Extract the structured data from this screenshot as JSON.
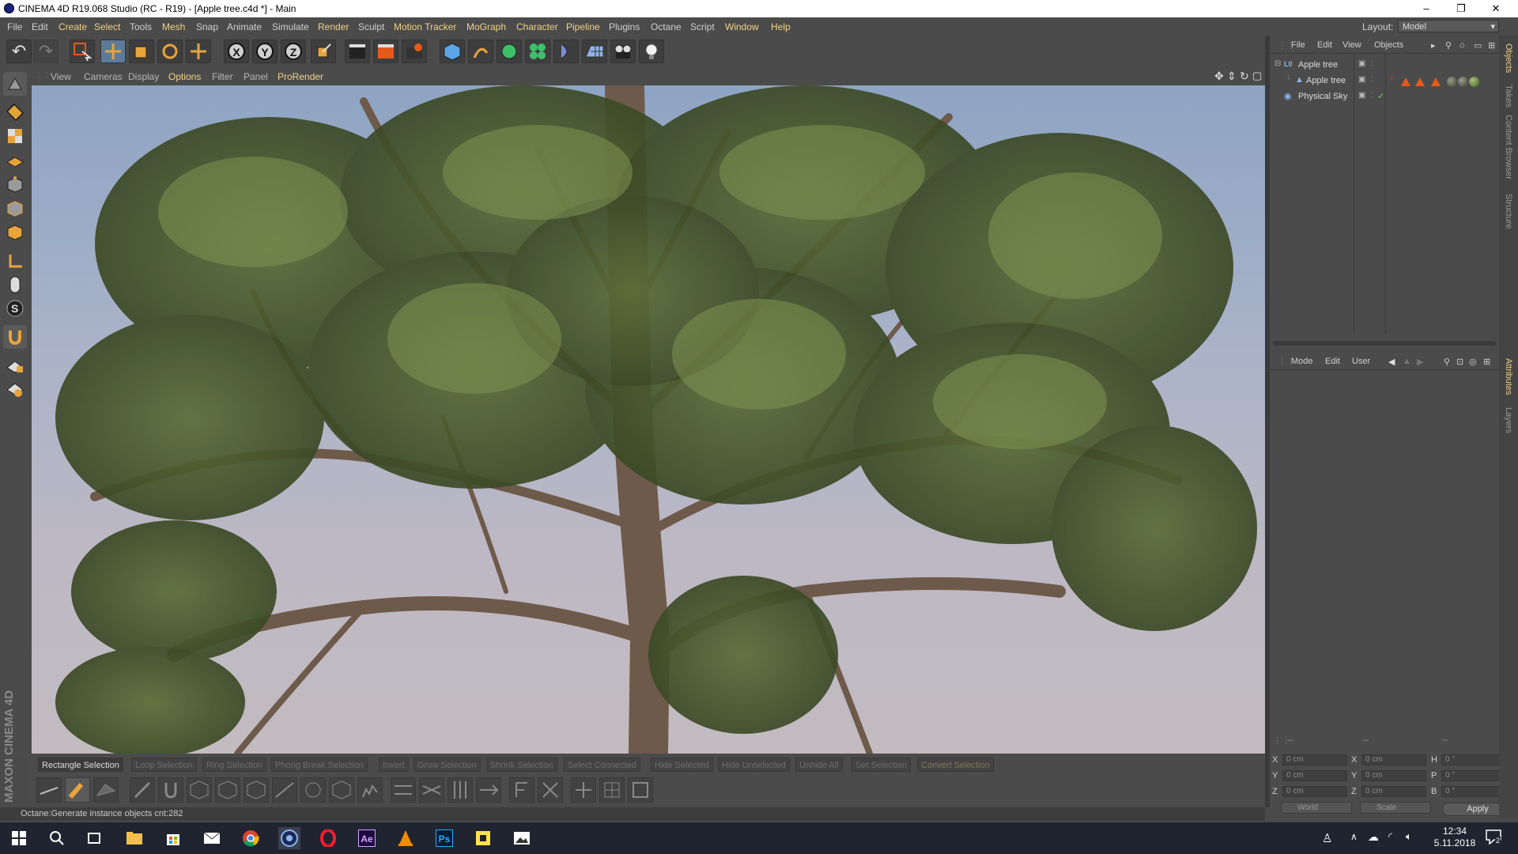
{
  "window": {
    "title": "CINEMA 4D R19.068 Studio (RC - R19) - [Apple tree.c4d *] - Main",
    "minimize": "–",
    "restore": "❐",
    "close": "✕"
  },
  "menubar": {
    "items": [
      "File",
      "Edit",
      "Create",
      "Select",
      "Tools",
      "Mesh",
      "Snap",
      "Animate",
      "Simulate",
      "Render",
      "Sculpt",
      "Motion Tracker",
      "MoGraph",
      "Character",
      "Pipeline",
      "Plugins",
      "Octane",
      "Script",
      "Window",
      "Help"
    ],
    "layout_label": "Layout:",
    "layout_value": "Model"
  },
  "viewport_menu": [
    "View",
    "Cameras",
    "Display",
    "Options",
    "Filter",
    "Panel",
    "ProRender"
  ],
  "axis_buttons": [
    "X",
    "Y",
    "Z"
  ],
  "selection_bar": [
    "Rectangle Selection",
    "Loop Selection",
    "Ring Selection",
    "Phong Break Selection",
    "Invert",
    "Grow Selection",
    "Shrink Selection",
    "Select Connected",
    "Hide Selected",
    "Hide Unselected",
    "Unhide All",
    "Set Selection",
    "Convert Selection"
  ],
  "status_text": "Octane:Generate instance objects cnt:282",
  "brand": "MAXON CINEMA 4D",
  "object_manager": {
    "menu": [
      "File",
      "Edit",
      "View",
      "Objects"
    ],
    "objects": [
      {
        "name": "Apple tree",
        "level": 0
      },
      {
        "name": "Apple tree",
        "level": 1
      },
      {
        "name": "Physical Sky",
        "level": 0
      }
    ]
  },
  "attribute_manager": {
    "menu": [
      "Mode",
      "Edit",
      "User"
    ]
  },
  "coordinates": {
    "header": [
      "--",
      "--",
      "--"
    ],
    "rows": [
      {
        "a": "X",
        "av": "0 cm",
        "b": "X",
        "bv": "0 cm",
        "c": "H",
        "cv": "0 °"
      },
      {
        "a": "Y",
        "av": "0 cm",
        "b": "Y",
        "bv": "0 cm",
        "c": "P",
        "cv": "0 °"
      },
      {
        "a": "Z",
        "av": "0 cm",
        "b": "Z",
        "bv": "0 cm",
        "c": "B",
        "cv": "0 °"
      }
    ],
    "space": "World",
    "mode": "Scale",
    "apply": "Apply"
  },
  "side_tabs": [
    "Objects",
    "Takes",
    "Content Browser",
    "Structure",
    "Attributes",
    "Layers"
  ],
  "taskbar": {
    "time": "12:34",
    "date": "5.11.2018",
    "notifications": "2",
    "app_labels": {
      "ae": "Ae",
      "ps": "Ps"
    }
  },
  "colors": {
    "accent": "#f0d28a",
    "panel": "#4b4b4b",
    "active_tool": "#5e7a9a",
    "octane_orange": "#e35a1c"
  }
}
